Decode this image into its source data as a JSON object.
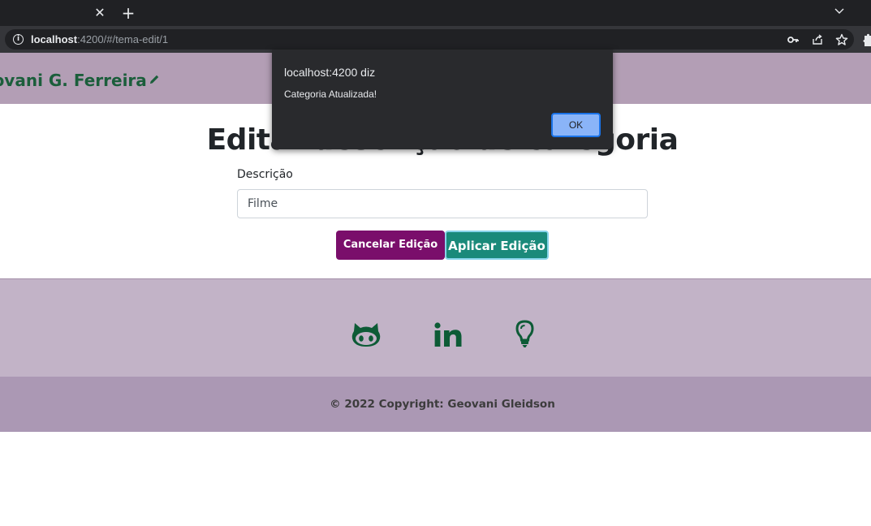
{
  "browser": {
    "tab_close": "✕",
    "new_tab": "+",
    "url_host": "localhost",
    "url_rest": ":4200/#/tema-edit/1",
    "icons": [
      "info-icon",
      "key-icon",
      "share-icon",
      "star-icon",
      "extensions-icon",
      "tab-list-icon"
    ]
  },
  "header": {
    "brand": "eovani G. Ferreira",
    "edit_icon": "pencil-icon",
    "color": "#b39eb5"
  },
  "form": {
    "title": "Editar descrição de categoria",
    "label": "Descrição",
    "value": "Filme",
    "cancel_label": "Cancelar Edição",
    "apply_label": "Aplicar Edição"
  },
  "footer": {
    "social_icons": [
      "github-icon",
      "linkedin-icon",
      "lightbulb-icon"
    ],
    "copyright": "© 2022 Copyright: Geovani Gleidson",
    "icon_color": "#0d5b36"
  },
  "alert": {
    "title": "localhost:4200 diz",
    "message": "Categoria Atualizada!",
    "ok_label": "OK"
  }
}
